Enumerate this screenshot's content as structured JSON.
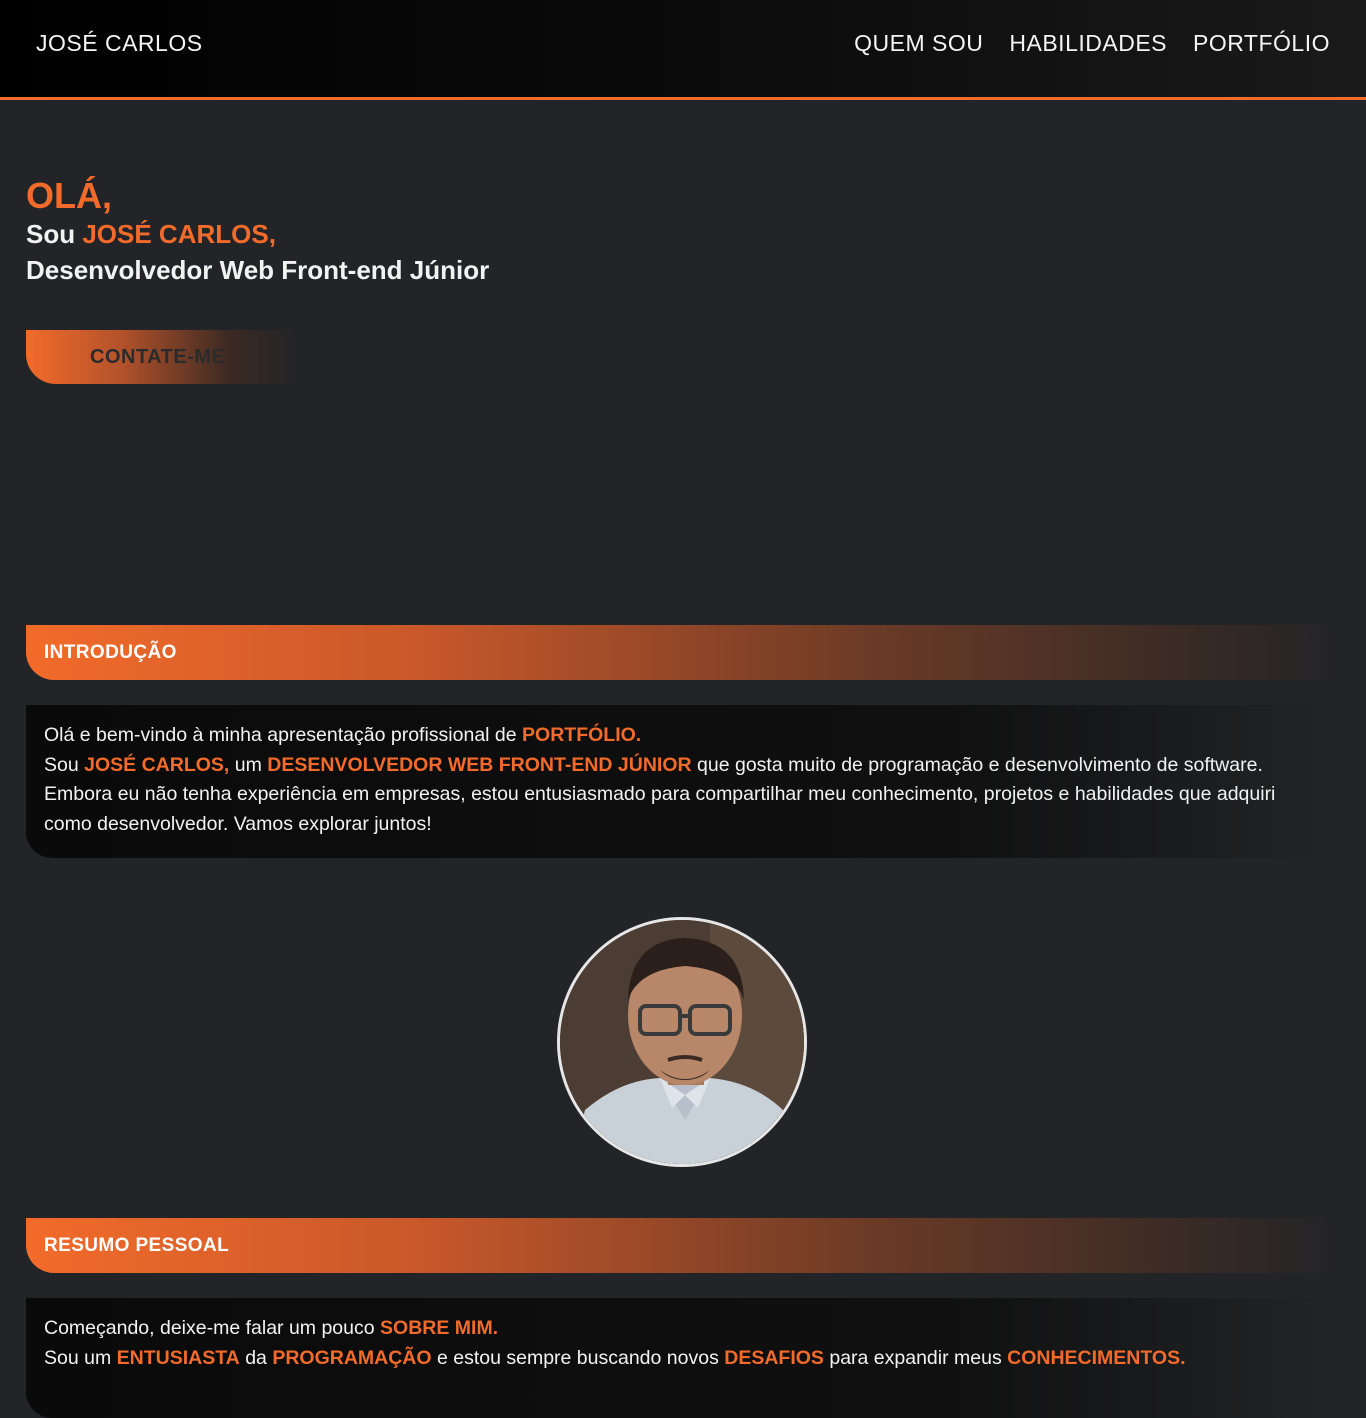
{
  "header": {
    "brand": "JOSÉ CARLOS",
    "nav": [
      "QUEM SOU",
      "HABILIDADES",
      "PORTFÓLIO"
    ]
  },
  "hero": {
    "hello": "OLÁ,",
    "iam_prefix": "Sou ",
    "name": "JOSÉ CARLOS,",
    "role": "Desenvolvedor Web Front-end Júnior",
    "cta": "CONTATE-ME"
  },
  "intro": {
    "title": "INTRODUÇÃO",
    "p1_text": "Olá e bem-vindo à minha apresentação profissional de ",
    "p1_hl": "PORTFÓLIO.",
    "p2_a": "Sou ",
    "p2_hl1": "JOSÉ CARLOS,",
    "p2_b": " um ",
    "p2_hl2": "DESENVOLVEDOR WEB FRONT-END JÚNIOR",
    "p2_c": " que gosta muito de programação e desenvolvimento de software. Embora eu não tenha experiência em empresas, estou entusiasmado para compartilhar meu conhecimento, projetos e habilidades que adquiri como desenvolvedor. Vamos explorar juntos!"
  },
  "resume": {
    "title": "RESUMO PESSOAL",
    "p1_text": "Começando, deixe-me falar um pouco ",
    "p1_hl": "SOBRE MIM.",
    "p2_a": "Sou um ",
    "p2_hl1": "ENTUSIASTA",
    "p2_b": " da ",
    "p2_hl2": "PROGRAMAÇÃO",
    "p2_c": " e estou sempre buscando novos ",
    "p2_hl3": "DESAFIOS",
    "p2_d": " para expandir meus ",
    "p2_hl4": "CONHECIMENTOS."
  },
  "colors": {
    "accent": "#f26b2a",
    "background": "#232427",
    "topbar": "#000000"
  },
  "icons": {
    "profile_photo": "profile-photo"
  }
}
